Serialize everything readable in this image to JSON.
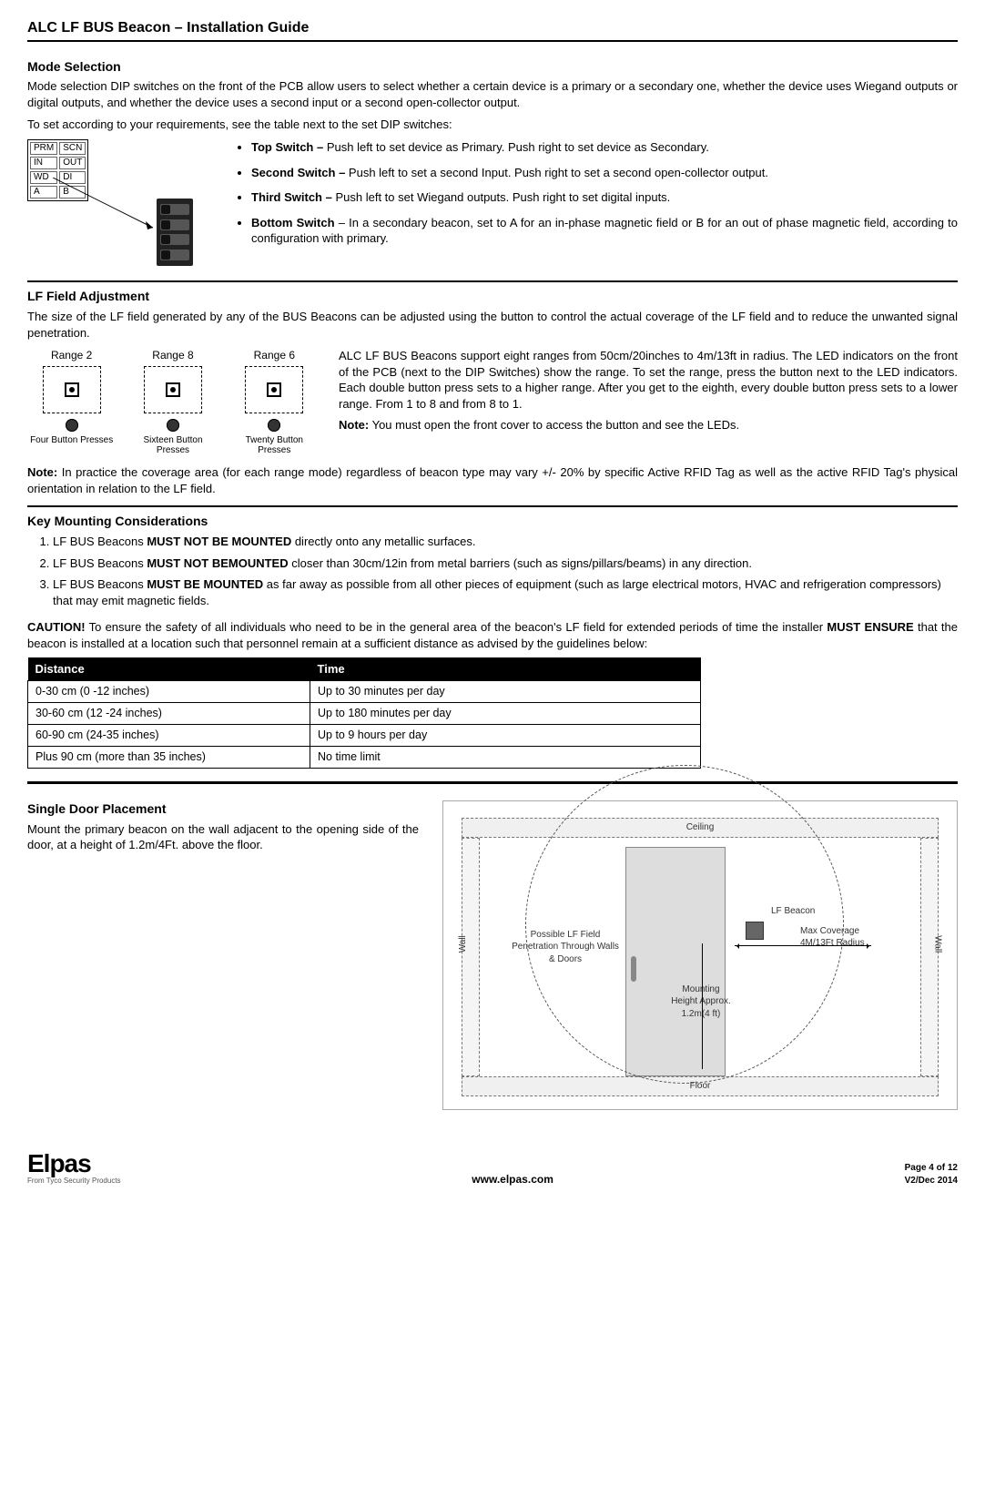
{
  "page_title": "ALC LF BUS Beacon – Installation Guide",
  "mode": {
    "heading": "Mode Selection",
    "p1": "Mode selection DIP switches on the front of the PCB allow users to select whether a certain device is a primary or a secondary one, whether the device uses Wiegand outputs or digital outputs, and whether the device uses a second input or a second open-collector output.",
    "p2": "To set according to your requirements, see the table next to the set DIP switches:",
    "switches": [
      {
        "label": "Top Switch – ",
        "text": "Push left to set device as Primary. Push right to set device as Secondary."
      },
      {
        "label": "Second Switch – ",
        "text": "Push left to set a second Input. Push right to set a second open-collector output."
      },
      {
        "label": "Third Switch – ",
        "text": "Push left to set Wiegand outputs. Push right to set digital inputs."
      },
      {
        "label": "Bottom Switch ",
        "text": "– In a secondary beacon, set to A for an in-phase magnetic field or B for an out of phase magnetic field, according to configuration with primary."
      }
    ],
    "dip_labels": [
      [
        "PRM",
        "SCN"
      ],
      [
        "IN",
        "OUT"
      ],
      [
        "WD",
        "DI"
      ],
      [
        "A",
        "B"
      ]
    ]
  },
  "lf": {
    "heading": "LF Field Adjustment",
    "p1": "The size of the LF field generated by any of the BUS Beacons can be adjusted using the button to control the actual coverage of the LF field and to reduce the unwanted signal penetration.",
    "ranges": [
      {
        "title": "Range 2",
        "presses": "Four Button Presses"
      },
      {
        "title": "Range 8",
        "presses": "Sixteen Button Presses"
      },
      {
        "title": "Range 6",
        "presses": "Twenty Button Presses"
      }
    ],
    "p2": "ALC LF BUS Beacons support eight ranges from 50cm/20inches to 4m/13ft in radius. The LED indicators on the front of the PCB (next to the DIP Switches) show the range. To set the range, press the button next to the LED indicators. Each double button press sets to a higher range. After you get to the eighth, every double button press sets to a lower range. From 1 to 8 and from 8 to 1.",
    "note_label": "Note:",
    "note_text": " You must open the front cover to access the button and see the LEDs.",
    "p3_label": "Note:",
    "p3_text": " In practice the coverage area (for each range mode) regardless of beacon type may vary +/- 20% by specific Active RFID Tag as well as the active RFID Tag's physical orientation in relation to the LF field."
  },
  "mount": {
    "heading": "Key Mounting Considerations",
    "items": [
      {
        "pre": "LF BUS Beacons ",
        "bold": "MUST NOT BE MOUNTED",
        "post": " directly onto any metallic surfaces."
      },
      {
        "pre": "LF BUS Beacons ",
        "bold": "MUST NOT BEMOUNTED",
        "post": " closer than 30cm/12in from metal barriers (such as signs/pillars/beams) in any direction."
      },
      {
        "pre": "LF BUS Beacons ",
        "bold": "MUST BE MOUNTED",
        "post": " as far away as possible from all other pieces of equipment (such as large electrical motors, HVAC and refrigeration compressors) that may emit magnetic fields."
      }
    ],
    "caution_label": "CAUTION!",
    "caution_pre": " To ensure the safety of all individuals who need to be in the general area of the beacon's LF field for extended periods of time the installer ",
    "caution_bold": "MUST ENSURE",
    "caution_post": " that the beacon is installed at a location such that personnel remain at a sufficient distance as advised by the guidelines below:"
  },
  "table": {
    "headers": [
      "Distance",
      "Time"
    ],
    "rows": [
      [
        "0-30 cm (0 -12 inches)",
        "Up to 30 minutes per day"
      ],
      [
        "30-60 cm (12 -24 inches)",
        "Up to 180 minutes per day"
      ],
      [
        "60-90 cm (24-35 inches)",
        "Up to 9 hours per day"
      ],
      [
        "Plus 90 cm (more than 35 inches)",
        "No time limit"
      ]
    ]
  },
  "placement": {
    "heading": "Single Door Placement",
    "text": "Mount the primary beacon on the wall adjacent to the opening side of the door, at a height of 1.2m/4Ft. above the floor.",
    "labels": {
      "ceiling": "Ceiling",
      "wall": "Wall",
      "floor": "Floor",
      "beacon": "LF Beacon",
      "penetration": "Possible LF Field Penetration Through Walls & Doors",
      "coverage": "Max Coverage 4M/13Ft Radius",
      "height": "Mounting Height Approx. 1.2m(4 ft)"
    }
  },
  "footer": {
    "logo": "Elpas",
    "logo_sub": "From Tyco Security Products",
    "url": "www.elpas.com",
    "page": "Page 4 of 12",
    "version": "V2/Dec 2014"
  }
}
